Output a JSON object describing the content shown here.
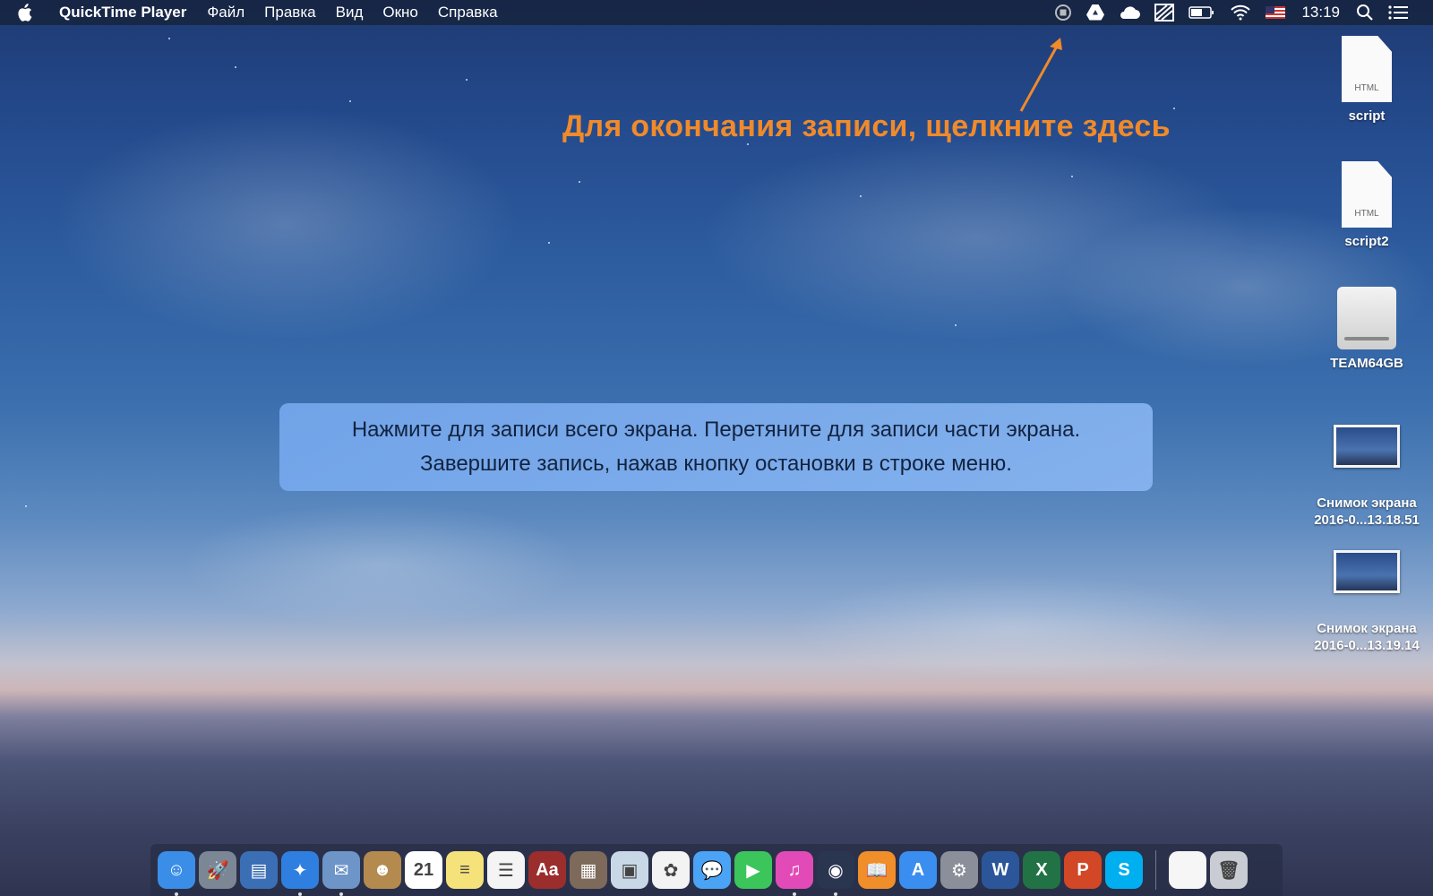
{
  "menubar": {
    "app_name": "QuickTime Player",
    "menus": [
      "Файл",
      "Правка",
      "Вид",
      "Окно",
      "Справка"
    ],
    "tray_icons": [
      "stop-recording-icon",
      "google-drive-icon",
      "cloud-icon",
      "status-icon",
      "battery-icon",
      "wifi-icon",
      "us-flag-icon"
    ],
    "clock": "13:19"
  },
  "annotation": {
    "text": "Для окончания записи, щелкните здесь",
    "color": "#f08a2a"
  },
  "hint": {
    "line1": "Нажмите для записи всего экрана. Перетяните для записи части экрана.",
    "line2": "Завершите запись, нажав кнопку остановки в строке меню."
  },
  "desktop": {
    "icons": [
      {
        "label": "script",
        "type_badge": "HTML"
      },
      {
        "label": "script2",
        "type_badge": "HTML"
      },
      {
        "label": "TEAM64GB"
      },
      {
        "label_line1": "Снимок экрана",
        "label_line2": "2016-0...13.18.51"
      },
      {
        "label_line1": "Снимок экрана",
        "label_line2": "2016-0...13.19.14"
      }
    ]
  },
  "dock": {
    "apps": [
      {
        "name": "finder",
        "color": "#3a8ee8",
        "glyph": "☺",
        "running": true
      },
      {
        "name": "launchpad",
        "color": "#7b8794",
        "glyph": "🚀",
        "running": false
      },
      {
        "name": "mission-control",
        "color": "#3b6fb5",
        "glyph": "▤",
        "running": false
      },
      {
        "name": "safari",
        "color": "#2f7fe0",
        "glyph": "✦",
        "running": true
      },
      {
        "name": "mail",
        "color": "#6d95c8",
        "glyph": "✉",
        "running": true
      },
      {
        "name": "contacts",
        "color": "#b58a4f",
        "glyph": "☻",
        "running": false
      },
      {
        "name": "calendar",
        "color": "#ffffff",
        "glyph": "21",
        "running": false
      },
      {
        "name": "notes",
        "color": "#f6e27a",
        "glyph": "≡",
        "running": false
      },
      {
        "name": "reminders",
        "color": "#f4f4f4",
        "glyph": "☰",
        "running": false
      },
      {
        "name": "dictionary",
        "color": "#9b2d2d",
        "glyph": "Aa",
        "running": false
      },
      {
        "name": "calculator",
        "color": "#7d6a5a",
        "glyph": "▦",
        "running": false
      },
      {
        "name": "preview",
        "color": "#c9d8e6",
        "glyph": "▣",
        "running": false
      },
      {
        "name": "photos",
        "color": "#f3f3f3",
        "glyph": "✿",
        "running": false
      },
      {
        "name": "messages",
        "color": "#4aa3f5",
        "glyph": "💬",
        "running": false
      },
      {
        "name": "facetime",
        "color": "#3bc55b",
        "glyph": "▶",
        "running": false
      },
      {
        "name": "itunes",
        "color": "#e24bb7",
        "glyph": "♫",
        "running": true
      },
      {
        "name": "quicktime",
        "color": "#2a3550",
        "glyph": "◉",
        "running": true
      },
      {
        "name": "ibooks",
        "color": "#f08e2a",
        "glyph": "📖",
        "running": false
      },
      {
        "name": "app-store",
        "color": "#3a8ef0",
        "glyph": "A",
        "running": false
      },
      {
        "name": "system-preferences",
        "color": "#8a8f99",
        "glyph": "⚙",
        "running": false
      },
      {
        "name": "word",
        "color": "#2b579a",
        "glyph": "W",
        "running": false
      },
      {
        "name": "excel",
        "color": "#217346",
        "glyph": "X",
        "running": false
      },
      {
        "name": "powerpoint",
        "color": "#d24726",
        "glyph": "P",
        "running": false
      },
      {
        "name": "skype",
        "color": "#00aff0",
        "glyph": "S",
        "running": false
      }
    ],
    "extras": [
      {
        "name": "document-stack",
        "color": "#f6f6f6",
        "glyph": ""
      },
      {
        "name": "trash",
        "color": "#c9cdd3",
        "glyph": "🗑"
      }
    ]
  }
}
